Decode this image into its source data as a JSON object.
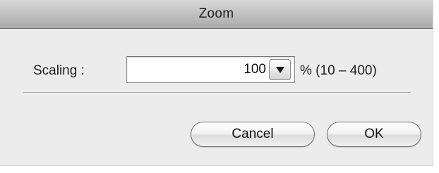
{
  "dialog": {
    "title": "Zoom"
  },
  "scaling": {
    "label": "Scaling :",
    "value": "100",
    "range_text": "% (10 – 400)"
  },
  "icons": {
    "dropdown": "chevron-down-icon"
  },
  "buttons": {
    "cancel_label": "Cancel",
    "ok_label": "OK"
  }
}
